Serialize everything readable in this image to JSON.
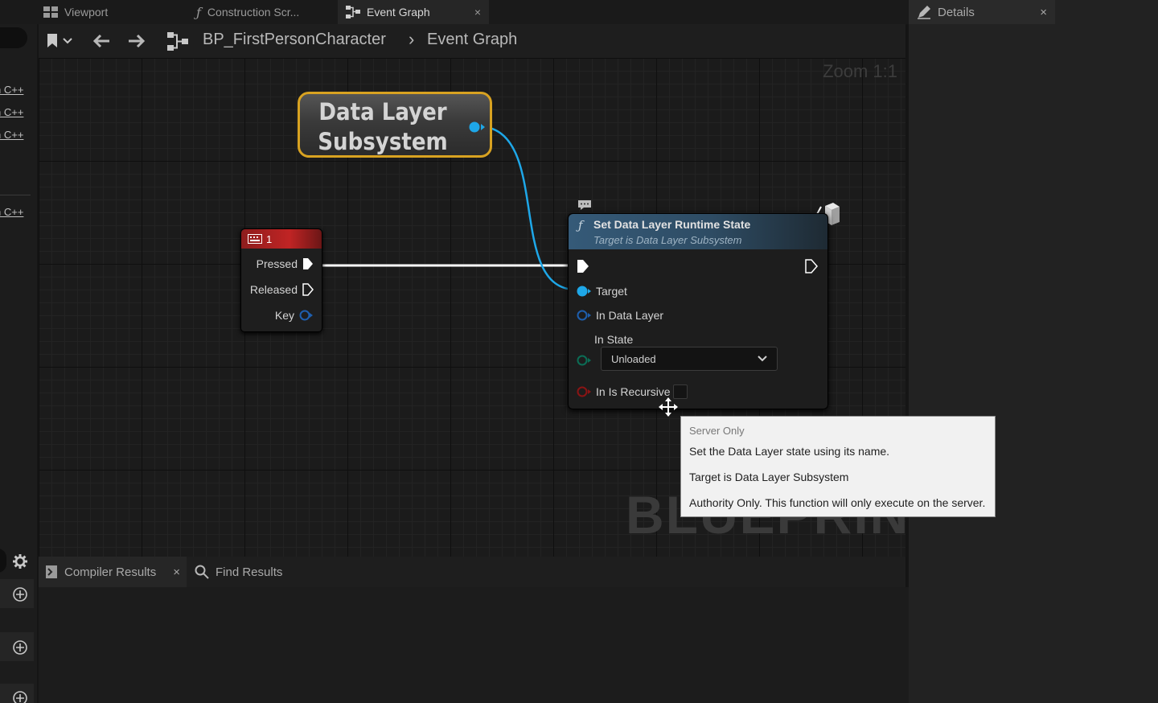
{
  "tabs": [
    {
      "label": "Viewport",
      "icon": "viewport-icon"
    },
    {
      "label": "Construction Scr...",
      "icon": "function-icon"
    },
    {
      "label": "Event Graph",
      "icon": "event-graph-icon",
      "active": true,
      "close": "×"
    }
  ],
  "breadcrumb": {
    "blueprint": "BP_FirstPersonCharacter",
    "separator": "›",
    "graph": "Event Graph",
    "zoom": "Zoom 1:1"
  },
  "left_panel": {
    "items": [
      "n C++",
      "n C++",
      "n C++",
      "n C++"
    ]
  },
  "nodes": {
    "data_layer_subsystem": {
      "title_line1": "Data Layer",
      "title_line2": "Subsystem"
    },
    "key_event": {
      "key": "1",
      "pins": [
        "Pressed",
        "Released",
        "Key"
      ]
    },
    "set_state": {
      "title": "Set Data Layer Runtime State",
      "subtitle": "Target is Data Layer Subsystem",
      "pins": {
        "target": "Target",
        "in_data_layer": "In Data Layer",
        "in_state": "In State",
        "in_is_recursive": "In Is Recursive"
      },
      "state_value": "Unloaded"
    }
  },
  "tooltip": {
    "line1": "Server Only",
    "line2": "Set the Data Layer state using its name.",
    "line3": "Target is Data Layer Subsystem",
    "line4": "Authority Only. This function will only execute on the server."
  },
  "watermark": "BLUEPRINT",
  "bottom_tabs": [
    {
      "label": "Compiler Results",
      "close": "×"
    },
    {
      "label": "Find Results"
    }
  ],
  "details": {
    "title": "Details",
    "close": "×"
  },
  "colors": {
    "exec_wire": "#ffffff",
    "object_pin": "#1ea7e8",
    "struct_pin": "#1e5fae",
    "enum_pin": "#0b6d55",
    "bool_pin": "#8a1414",
    "node_border": "#d8a221",
    "key_header": "#c02424",
    "function_header": "#355a78"
  }
}
